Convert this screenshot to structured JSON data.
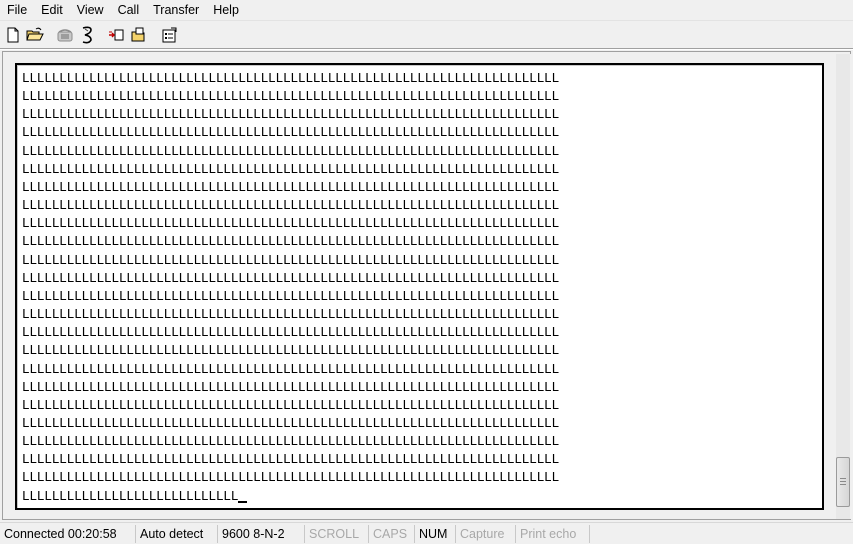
{
  "menu": {
    "file": "File",
    "edit": "Edit",
    "view": "View",
    "call": "Call",
    "transfer": "Transfer",
    "help": "Help"
  },
  "toolbar": {
    "icons": [
      "new-file-icon",
      "open-folder-icon",
      "disconnect-phone-icon",
      "dial-icon",
      "send-file-icon",
      "receive-file-icon",
      "properties-icon"
    ]
  },
  "terminal": {
    "char": "L",
    "chars_per_row": 72,
    "full_rows": 23,
    "last_row_chars": 29
  },
  "status": {
    "connected": "Connected 00:20:58",
    "detect": "Auto detect",
    "settings": "9600 8-N-2",
    "scroll": "SCROLL",
    "caps": "CAPS",
    "num": "NUM",
    "capture": "Capture",
    "print_echo": "Print echo"
  },
  "colors": {
    "window_bg": "#f0f0f0",
    "terminal_bg": "#ffffff",
    "disabled_text": "#a8a8a8"
  }
}
